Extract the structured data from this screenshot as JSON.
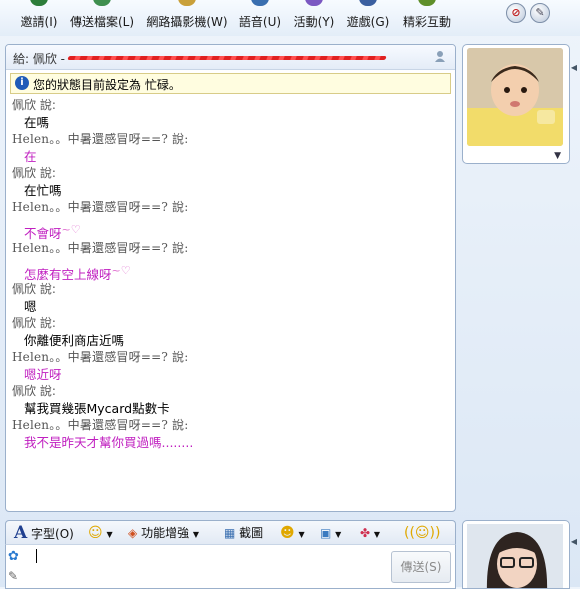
{
  "toolbar": {
    "items": [
      {
        "label": "邀請(I)",
        "icon": "invite-icon"
      },
      {
        "label": "傳送檔案(L)",
        "icon": "send-file-icon"
      },
      {
        "label": "網路攝影機(W)",
        "icon": "webcam-icon"
      },
      {
        "label": "語音(U)",
        "icon": "voice-icon"
      },
      {
        "label": "活動(Y)",
        "icon": "activities-icon"
      },
      {
        "label": "遊戲(G)",
        "icon": "games-icon"
      },
      {
        "label": "精彩互動",
        "icon": "interactive-icon"
      }
    ],
    "block_icon": "block-icon",
    "menu_icon": "menu-icon"
  },
  "chat": {
    "to_label": "給: 佩欣 -",
    "status": "您的狀態目前設定為 忙碌。",
    "messages": [
      {
        "sender": "佩欣 說:",
        "text": "在嗎",
        "who": "self"
      },
      {
        "sender": "Helen。。中暑還感冒呀==? 說:",
        "text": "在",
        "who": "helen"
      },
      {
        "sender": "佩欣 說:",
        "text": "在忙嗎",
        "who": "self"
      },
      {
        "sender": "Helen。。中暑還感冒呀==? 說:",
        "text": "不會呀",
        "emote": "~♡",
        "who": "helen"
      },
      {
        "sender": "Helen。。中暑還感冒呀==? 說:",
        "text": "怎麼有空上線呀",
        "emote": "~♡",
        "who": "helen"
      },
      {
        "sender": "佩欣 說:",
        "text": "嗯",
        "who": "self"
      },
      {
        "sender": "佩欣 說:",
        "text": "你離便利商店近嗎",
        "who": "self"
      },
      {
        "sender": "Helen。。中暑還感冒呀==? 說:",
        "text": "嗯近呀",
        "who": "helen"
      },
      {
        "sender": "佩欣 說:",
        "text": "幫我買幾張Mycard點數卡",
        "who": "self"
      },
      {
        "sender": "Helen。。中暑還感冒呀==? 說:",
        "text": "我不是昨天才幫你買過嗎........",
        "who": "helen"
      }
    ]
  },
  "format_bar": {
    "font_label": "字型(O)",
    "features_label": "功能增強",
    "screenshot_label": "截圖"
  },
  "compose": {
    "send_label": "傳送(S)"
  },
  "colors": {
    "helen_text": "#c020c0",
    "accent": "#1f5bb8"
  }
}
